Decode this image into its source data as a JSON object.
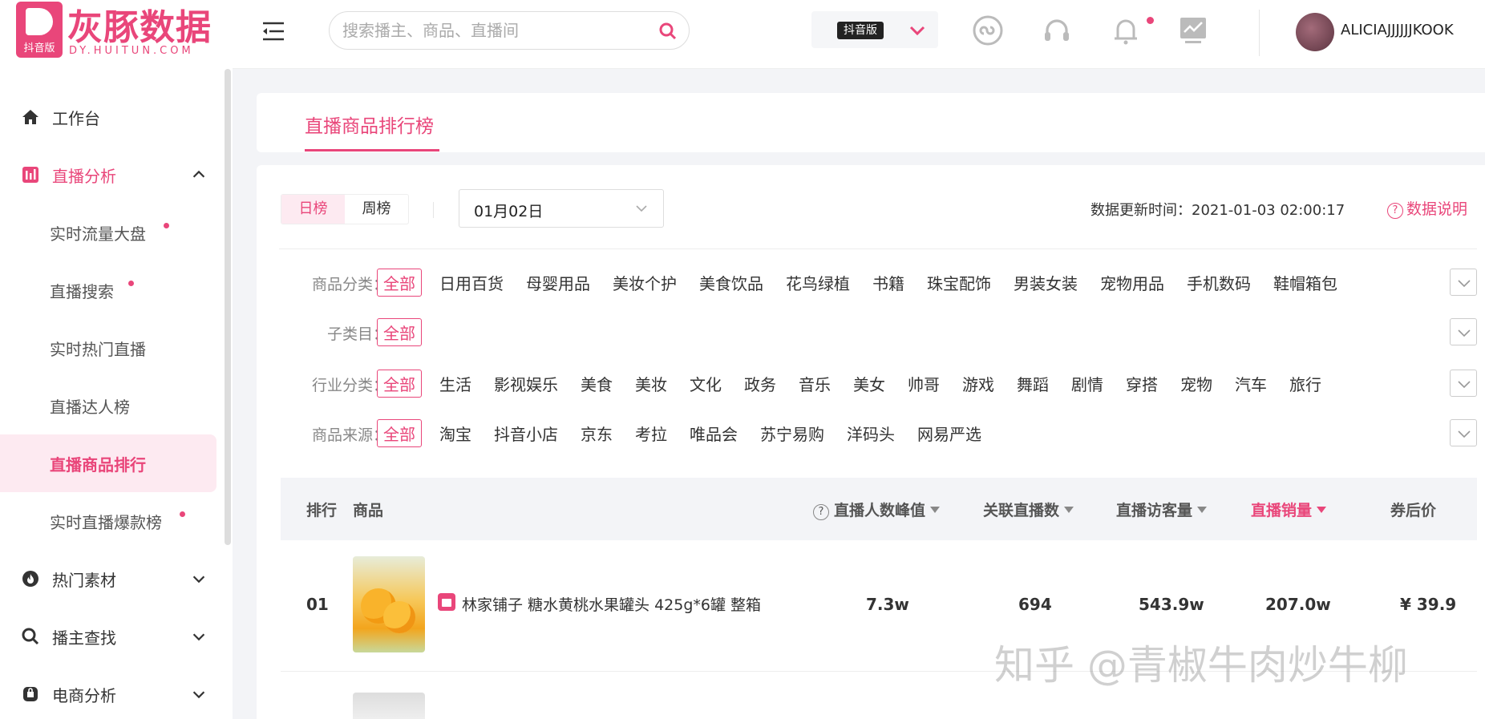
{
  "logo": {
    "name": "灰豚数据",
    "url": "DY.HUITUN.COM",
    "sub": "抖音版"
  },
  "sidebar": {
    "items": [
      {
        "label": "工作台",
        "icon": "home-icon"
      },
      {
        "label": "直播分析",
        "icon": "chart-bar-icon",
        "open": true
      },
      {
        "label": "热门素材",
        "icon": "fire-icon"
      },
      {
        "label": "播主查找",
        "icon": "search-icon"
      },
      {
        "label": "电商分析",
        "icon": "shopping-bag-icon"
      }
    ],
    "sub": [
      {
        "label": "实时流量大盘",
        "dot": true
      },
      {
        "label": "直播搜索",
        "dot": true
      },
      {
        "label": "实时热门直播",
        "dot": false
      },
      {
        "label": "直播达人榜",
        "dot": false
      },
      {
        "label": "直播商品排行",
        "dot": false,
        "active": true
      },
      {
        "label": "实时直播爆款榜",
        "dot": true
      }
    ]
  },
  "header": {
    "search_placeholder": "搜索播主、商品、直播间",
    "version_badge": "抖音版",
    "username": "ALICIAJJJJJJKOOK"
  },
  "page": {
    "title": "直播商品排行榜"
  },
  "toolbar": {
    "tabs": [
      "日榜",
      "周榜"
    ],
    "date": "01月02日",
    "update_label": "数据更新时间：2021-01-03 02:00:17",
    "help": "数据说明"
  },
  "filters": [
    {
      "label": "商品分类：",
      "options": [
        "全部",
        "日用百货",
        "母婴用品",
        "美妆个护",
        "美食饮品",
        "花鸟绿植",
        "书籍",
        "珠宝配饰",
        "男装女装",
        "宠物用品",
        "手机数码",
        "鞋帽箱包"
      ]
    },
    {
      "label": "子类目：",
      "options": [
        "全部"
      ]
    },
    {
      "label": "行业分类：",
      "options": [
        "全部",
        "生活",
        "影视娱乐",
        "美食",
        "美妆",
        "文化",
        "政务",
        "音乐",
        "美女",
        "帅哥",
        "游戏",
        "舞蹈",
        "剧情",
        "穿搭",
        "宠物",
        "汽车",
        "旅行"
      ]
    },
    {
      "label": "商品来源：",
      "options": [
        "全部",
        "淘宝",
        "抖音小店",
        "京东",
        "考拉",
        "唯品会",
        "苏宁易购",
        "洋码头",
        "网易严选"
      ]
    }
  ],
  "table": {
    "headers": {
      "rank": "排行",
      "product": "商品",
      "peak": "直播人数峰值",
      "live_count": "关联直播数",
      "visitors": "直播访客量",
      "sales": "直播销量",
      "price": "券后价"
    },
    "rows": [
      {
        "rank": "01",
        "name": "林家铺子 糖水黄桃水果罐头 425g*6罐 整箱",
        "peak": "7.3w",
        "live_count": "694",
        "visitors": "543.9w",
        "sales": "207.0w",
        "price": "¥ 39.9"
      }
    ]
  },
  "watermark": "知乎 @青椒牛肉炒牛柳",
  "colors": {
    "accent": "#e9467a",
    "bg": "#f3f4f7"
  }
}
